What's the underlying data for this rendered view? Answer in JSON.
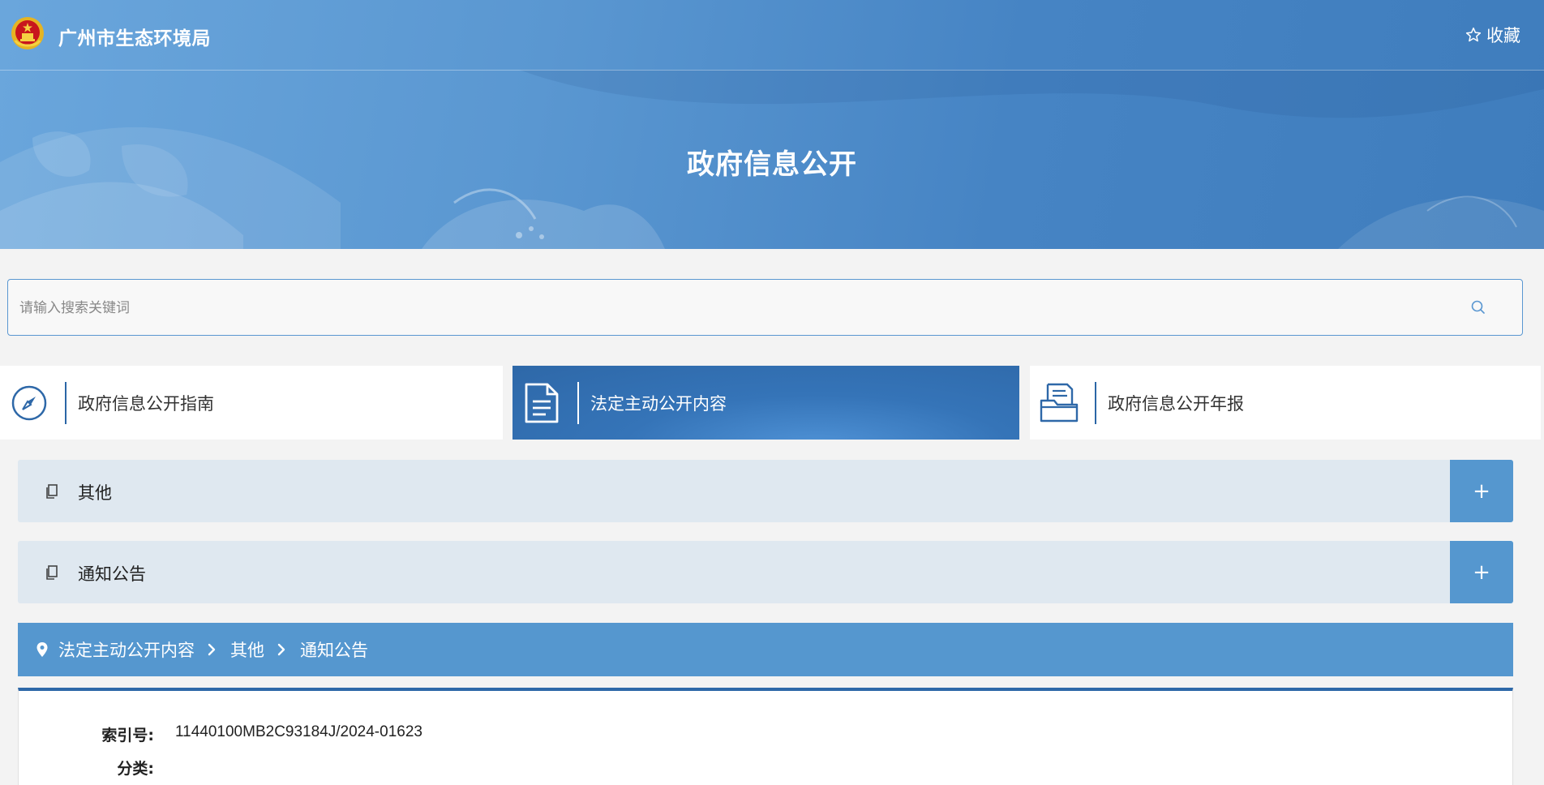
{
  "header": {
    "site_title": "广州市生态环境局",
    "favorite_label": "收藏",
    "banner_title": "政府信息公开"
  },
  "search": {
    "placeholder": "请输入搜索关键词",
    "value": ""
  },
  "tabs": [
    {
      "label": "政府信息公开指南",
      "icon": "compass-icon",
      "active": false
    },
    {
      "label": "法定主动公开内容",
      "icon": "document-icon",
      "active": true
    },
    {
      "label": "政府信息公开年报",
      "icon": "folder-document-icon",
      "active": false
    }
  ],
  "accordions": [
    {
      "label": "其他",
      "toggle": "+"
    },
    {
      "label": "通知公告",
      "toggle": "+"
    }
  ],
  "breadcrumb": [
    "法定主动公开内容",
    "其他",
    "通知公告"
  ],
  "details": [
    {
      "key": "索引号:",
      "value": "11440100MB2C93184J/2024-01623"
    },
    {
      "key": "分类:",
      "value": ""
    }
  ],
  "colors": {
    "primary": "#2e68a8",
    "accent": "#5597cf",
    "accordion_bg": "#dfe8f0"
  }
}
